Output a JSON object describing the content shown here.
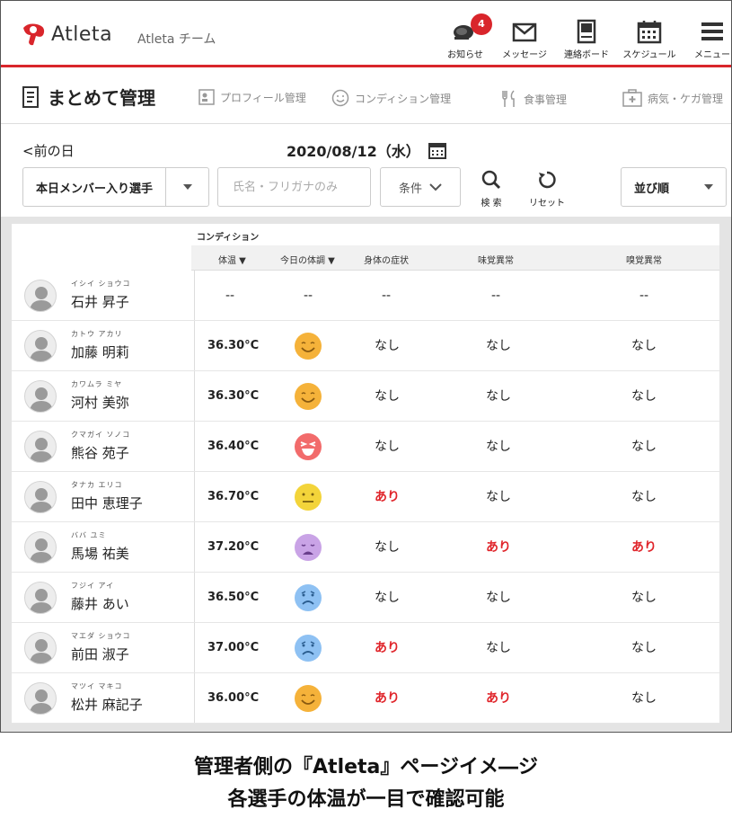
{
  "header": {
    "logo_text": "Atleta",
    "team_name": "Atleta チーム",
    "notification_count": "4",
    "nav": [
      {
        "label": "お知らせ",
        "icon": "megaphone-icon"
      },
      {
        "label": "メッセージ",
        "icon": "envelope-icon"
      },
      {
        "label": "連絡ボード",
        "icon": "board-icon"
      },
      {
        "label": "スケジュール",
        "icon": "calendar-icon"
      },
      {
        "label": "メニュー",
        "icon": "hamburger-icon"
      }
    ],
    "accent_color": "#d9252b"
  },
  "subheader": {
    "title": "まとめて管理",
    "tabs": [
      {
        "label": "プロフィール管理",
        "icon": "profile-icon"
      },
      {
        "label": "コンディション管理",
        "icon": "smile-icon"
      },
      {
        "label": "食事管理",
        "icon": "fork-knife-icon"
      },
      {
        "label": "病気・ケガ管理",
        "icon": "first-aid-icon"
      }
    ]
  },
  "date_nav": {
    "prev_label": "前の日",
    "date": "2020/08/12（水）"
  },
  "filters": {
    "member_select": "本日メンバー入り選手",
    "name_placeholder": "氏名・フリガナのみ",
    "condition_label": "条件",
    "search_label": "検 索",
    "reset_label": "リセット",
    "sort_label": "並び順"
  },
  "table": {
    "group_label": "コンディション",
    "columns": [
      "体温 ▼",
      "今日の体調 ▼",
      "身体の症状",
      "味覚異常",
      "嗅覚異常"
    ],
    "rows": [
      {
        "kana": "イシイ ショウコ",
        "name": "石井 昇子",
        "temp": "--",
        "mood": "none",
        "symptom": "--",
        "taste": "--",
        "smell": "--"
      },
      {
        "kana": "カトウ アカリ",
        "name": "加藤 明莉",
        "temp": "36.30°C",
        "mood": "smile",
        "symptom": "なし",
        "taste": "なし",
        "smell": "なし"
      },
      {
        "kana": "カワムラ ミヤ",
        "name": "河村 美弥",
        "temp": "36.30°C",
        "mood": "smile",
        "symptom": "なし",
        "taste": "なし",
        "smell": "なし"
      },
      {
        "kana": "クマガイ ソノコ",
        "name": "熊谷 苑子",
        "temp": "36.40°C",
        "mood": "laugh",
        "symptom": "なし",
        "taste": "なし",
        "smell": "なし"
      },
      {
        "kana": "タナカ エリコ",
        "name": "田中 恵理子",
        "temp": "36.70°C",
        "mood": "neutral",
        "symptom": "あり",
        "taste": "なし",
        "smell": "なし"
      },
      {
        "kana": "ババ ユミ",
        "name": "馬場 祐美",
        "temp": "37.20°C",
        "mood": "cry",
        "symptom": "なし",
        "taste": "あり",
        "smell": "あり"
      },
      {
        "kana": "フジイ アイ",
        "name": "藤井 あい",
        "temp": "36.50°C",
        "mood": "sad",
        "symptom": "なし",
        "taste": "なし",
        "smell": "なし"
      },
      {
        "kana": "マエダ ショウコ",
        "name": "前田 淑子",
        "temp": "37.00°C",
        "mood": "sad",
        "symptom": "あり",
        "taste": "なし",
        "smell": "なし"
      },
      {
        "kana": "マツイ マキコ",
        "name": "松井 麻記子",
        "temp": "36.00°C",
        "mood": "smile",
        "symptom": "あり",
        "taste": "あり",
        "smell": "なし"
      }
    ],
    "mood_colors": {
      "smile": "#f5b23a",
      "laugh": "#f26b6b",
      "neutral": "#f3d43a",
      "cry": "#c9a3e6",
      "sad": "#8ec1f3"
    },
    "alert_color": "#e0252b"
  },
  "caption": {
    "line1": "管理者側の『Atleta』ページイメ―ジ",
    "line2": "各選手の体温が一目で確認可能"
  }
}
